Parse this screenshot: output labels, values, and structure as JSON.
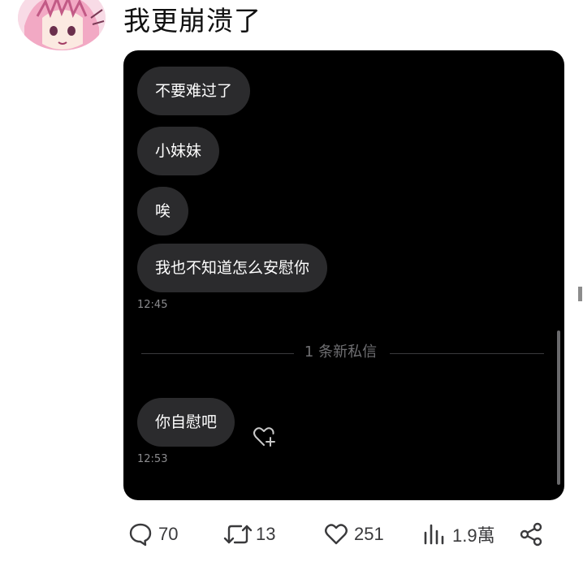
{
  "post": {
    "text": "我更崩溃了"
  },
  "dm": {
    "messages": [
      {
        "text": "不要难过了"
      },
      {
        "text": "小妹妹"
      },
      {
        "text": "唉"
      },
      {
        "text": "我也不知道怎么安慰你"
      },
      {
        "text": "你自慰吧"
      }
    ],
    "timestamps": [
      "12:45",
      "12:53"
    ],
    "divider_label": "1 条新私信"
  },
  "actions": {
    "replies": "70",
    "reposts": "13",
    "likes": "251",
    "views": "1.9萬"
  },
  "icons": {
    "reply": "speech-bubble-icon",
    "repost": "repost-arrows-icon",
    "like": "heart-icon",
    "views": "bar-chart-icon",
    "share": "share-icon",
    "react": "heart-plus-icon"
  },
  "colors": {
    "dm_background": "#000000",
    "bubble": "#2b2b2d",
    "bubble_text": "#ffffff",
    "timestamp": "#8b8b8e",
    "action_icons": "#3a3a3c"
  }
}
